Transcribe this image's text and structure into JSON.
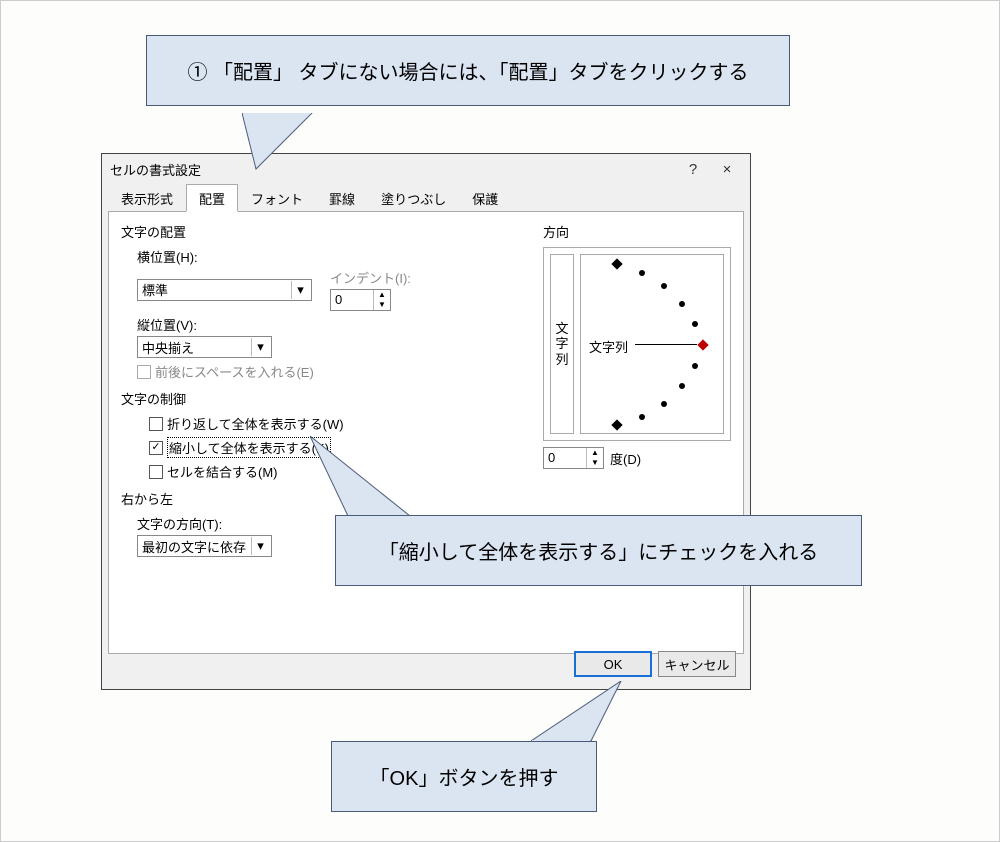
{
  "callouts": {
    "c1": "① 「配置」 タブにない場合には、「配置」タブをクリックする",
    "c2": "「縮小して全体を表示する」にチェックを入れる",
    "c3": "「OK」ボタンを押す"
  },
  "dialog": {
    "title": "セルの書式設定",
    "help": "?",
    "close": "×",
    "tabs": [
      "表示形式",
      "配置",
      "フォント",
      "罫線",
      "塗りつぶし",
      "保護"
    ],
    "active_tab": 1,
    "groups": {
      "text_align": "文字の配置",
      "horizontal_label": "横位置(H):",
      "horizontal_value": "標準",
      "indent_label": "インデント(I):",
      "indent_value": "0",
      "vertical_label": "縦位置(V):",
      "vertical_value": "中央揃え",
      "justify_label": "前後にスペースを入れる(E)",
      "text_control": "文字の制御",
      "wrap": "折り返して全体を表示する(W)",
      "shrink": "縮小して全体を表示する(K)",
      "merge": "セルを結合する(M)",
      "rtl": "右から左",
      "text_dir_label": "文字の方向(T):",
      "text_dir_value": "最初の文字に依存",
      "orientation_label": "方向",
      "orientation_vertical": "文字列",
      "orientation_inline": "文字列",
      "degree_value": "0",
      "degree_label": "度(D)"
    },
    "buttons": {
      "ok": "OK",
      "cancel": "キャンセル"
    }
  }
}
